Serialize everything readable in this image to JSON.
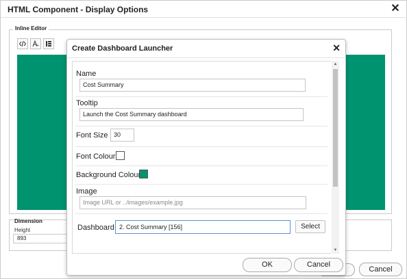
{
  "outer_dialog": {
    "title": "HTML Component - Display Options",
    "close_icon": "close-icon",
    "inline_editor_legend": "Inline Editor",
    "toolbar": {
      "source_icon_label": "</>",
      "font_icon_label": "A",
      "block_icon_label": "▮"
    },
    "canvas_color": "#00936f",
    "dimension": {
      "legend": "Dimension",
      "height_label": "Height",
      "height_value": "893"
    },
    "ok_label": "OK",
    "cancel_label": "Cancel"
  },
  "modal": {
    "title": "Create Dashboard Launcher",
    "close_icon": "close-icon",
    "name": {
      "label": "Name",
      "value": "Cost Summary"
    },
    "tooltip": {
      "label": "Tooltip",
      "value": "Launch the Cost  Summary dashboard"
    },
    "font_size": {
      "label": "Font Size",
      "value": "30"
    },
    "font_colour": {
      "label": "Font Colour",
      "color": "#ffffff"
    },
    "background_colour": {
      "label": "Background Colour",
      "color": "#00936f"
    },
    "image": {
      "label": "Image",
      "placeholder": "Image URL or ../images/example.jpg"
    },
    "dashboard": {
      "label": "Dashboard",
      "value": "2. Cost Summary [156]",
      "select_label": "Select"
    },
    "ok_label": "OK",
    "cancel_label": "Cancel"
  }
}
